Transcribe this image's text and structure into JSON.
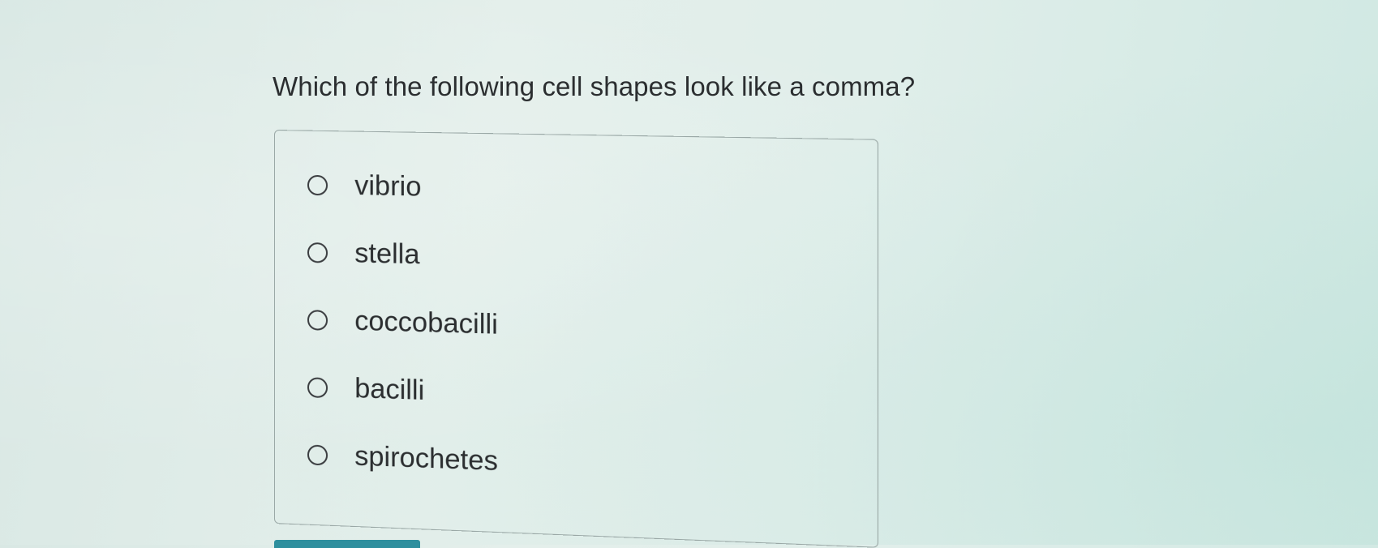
{
  "question": {
    "text": "Which of the following cell shapes look like a comma?"
  },
  "options": [
    {
      "label": "vibrio"
    },
    {
      "label": "stella"
    },
    {
      "label": "coccobacilli"
    },
    {
      "label": "bacilli"
    },
    {
      "label": "spirochetes"
    }
  ],
  "colors": {
    "accent": "#2e8f9e",
    "text": "#2b2e30"
  }
}
